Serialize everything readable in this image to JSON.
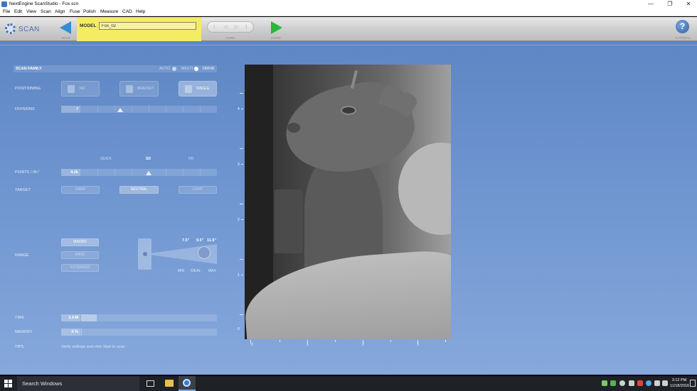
{
  "window": {
    "title": "NextEngine ScanStudio - Fox.scn",
    "minimize": "—",
    "restore": "❐",
    "close": "✕"
  },
  "menu": [
    "File",
    "Edit",
    "View",
    "Scan",
    "Align",
    "Fuse",
    "Polish",
    "Measure",
    "CAD",
    "Help"
  ],
  "toolbar": {
    "scan_label": "SCAN",
    "back_label": "BACK",
    "model_label": "MODEL",
    "model_value": "Fox_02",
    "turn_label": "TURN",
    "start_label": "START",
    "help_label": "TUTORIAL"
  },
  "panel": {
    "scan_family": "SCAN FAMILY",
    "family_opts": [
      "AUTO",
      "MULTI",
      "DRIVE"
    ],
    "positioning_label": "POSITIONING",
    "positioning_opts": [
      "360",
      "BRACKET",
      "SINGLE"
    ],
    "positioning_selected": "SINGLE",
    "divisions_label": "DIVISIONS",
    "divisions_value": "7",
    "quality_opts": [
      "QUICK",
      "SD",
      "HD"
    ],
    "points_label": "POINTS / IN.²",
    "points_value": "4.2k",
    "target_label": "TARGET",
    "target_opts": [
      "DARK",
      "NEUTRAL",
      "LIGHT"
    ],
    "target_selected": "NEUTRAL",
    "range_label": "RANGE",
    "range_opts": [
      "MACRO",
      "WIDE",
      "EXTENDED"
    ],
    "range_selected": "MACRO",
    "range_distances": [
      "7.5\"",
      "9.5\"",
      "11.5\""
    ],
    "range_marks": [
      "MIN",
      "IDEAL",
      "MAX"
    ],
    "time_label": "TIME",
    "time_value": "3.4 M",
    "memory_label": "MEMORY",
    "memory_value": "0 %",
    "tips_label": "TIPS",
    "tips_text": "Verify settings and click Start to scan"
  },
  "preview": {
    "ruler_v": [
      "4",
      "3",
      "2",
      "1",
      "0"
    ],
    "ruler_h": [
      "0",
      "1",
      "2",
      "3"
    ]
  },
  "taskbar": {
    "search_placeholder": "Search Windows",
    "time": "3:12 PM",
    "date": "11/18/2016"
  }
}
